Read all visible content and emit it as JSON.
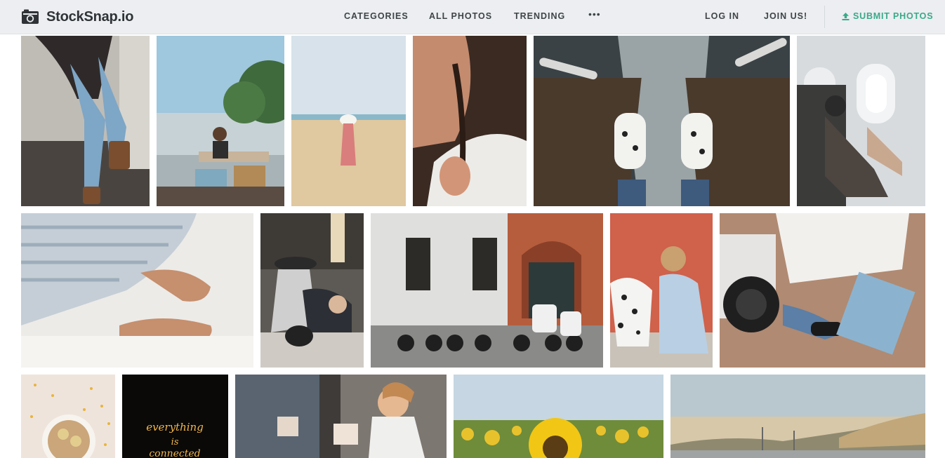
{
  "brand": {
    "name": "StockSnap.io",
    "icon": "camera-icon"
  },
  "nav": {
    "categories": "CATEGORIES",
    "all_photos": "ALL PHOTOS",
    "trending": "TRENDING",
    "more": "•••",
    "login": "LOG IN",
    "join": "JOIN US!",
    "submit": "SUBMIT PHOTOS",
    "submit_icon": "upload-icon"
  },
  "colors": {
    "header_bg": "#eceef1",
    "accent": "#3aa98a",
    "nav_text": "#3f4448"
  },
  "gallery": {
    "neon_sign": [
      "everything",
      "is",
      "connected"
    ]
  }
}
